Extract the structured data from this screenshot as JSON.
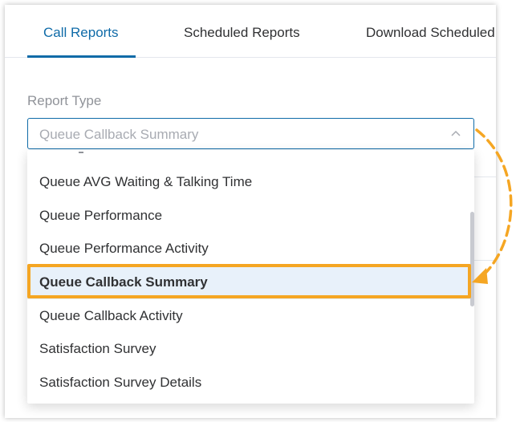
{
  "tabs": [
    {
      "label": "Call Reports",
      "active": true
    },
    {
      "label": "Scheduled Reports",
      "active": false
    },
    {
      "label": "Download Scheduled Reports",
      "active": false
    }
  ],
  "report_type": {
    "label": "Report Type",
    "selected_value": "Queue Callback Summary"
  },
  "dropdown": {
    "options": [
      "Queue AVG Waiting & Talking Time",
      "Queue Performance",
      "Queue Performance Activity",
      "Queue Callback Summary",
      "Queue Callback Activity",
      "Satisfaction Survey",
      "Satisfaction Survey Details"
    ],
    "selected_option": "Queue Callback Summary"
  },
  "icons": {
    "select_arrow": "chevron-up-icon",
    "annotation_arrow": "dashed-curved-arrow-icon"
  },
  "colors": {
    "accent": "#0f6ba8",
    "highlight": "#f5a623",
    "selected_bg": "#e8f1fa"
  }
}
